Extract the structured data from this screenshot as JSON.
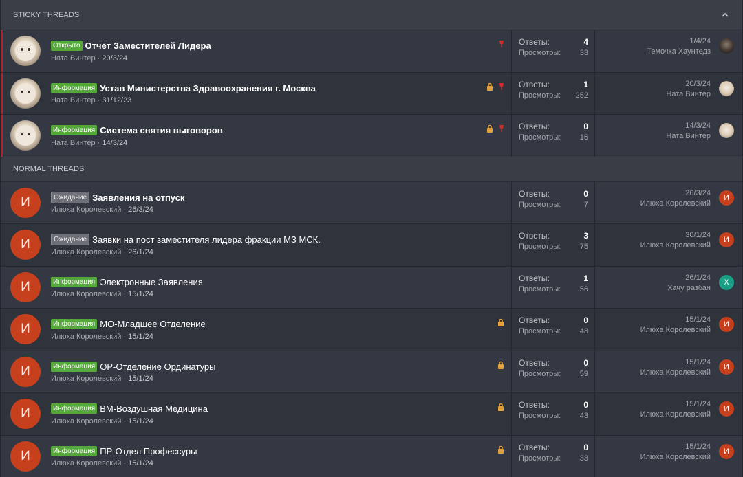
{
  "sticky_section": {
    "title": "STICKY THREADS"
  },
  "normal_section": {
    "title": "NORMAL THREADS"
  },
  "stats_labels": {
    "replies": "Ответы:",
    "views": "Просмотры:"
  },
  "sticky_threads": [
    {
      "prefix": "Открыто",
      "prefix_color": "green",
      "title": "Отчёт Заместителей Лидера",
      "author": "Ната Винтер",
      "date": "20/3/24",
      "locked": false,
      "pinned": true,
      "replies": "4",
      "views": "33",
      "last_date": "1/4/24",
      "last_user": "Темочка Хаунтедз",
      "avatar": "photo",
      "last_avatar": "dark"
    },
    {
      "prefix": "Информация",
      "prefix_color": "green",
      "title": "Устав Министерства Здравоохранения г. Москва",
      "author": "Ната Винтер",
      "date": "31/12/23",
      "locked": true,
      "pinned": true,
      "replies": "1",
      "views": "252",
      "last_date": "20/3/24",
      "last_user": "Ната Винтер",
      "avatar": "photo",
      "last_avatar": "photo"
    },
    {
      "prefix": "Информация",
      "prefix_color": "green",
      "title": "Система снятия выговоров",
      "author": "Ната Винтер",
      "date": "14/3/24",
      "locked": true,
      "pinned": true,
      "replies": "0",
      "views": "16",
      "last_date": "14/3/24",
      "last_user": "Ната Винтер",
      "avatar": "photo",
      "last_avatar": "photo"
    }
  ],
  "normal_threads": [
    {
      "prefix": "Ожидание",
      "prefix_color": "grey",
      "title": "Заявления на отпуск",
      "bold": true,
      "author": "Илюха Королевский",
      "date": "26/3/24",
      "locked": false,
      "replies": "0",
      "views": "7",
      "last_date": "26/3/24",
      "last_user": "Илюха Королевский",
      "avatar_letter": "И",
      "last_avatar": "red",
      "last_letter": "И"
    },
    {
      "prefix": "Ожидание",
      "prefix_color": "grey",
      "title": "Заявки на пост заместителя лидера фракции МЗ МСК.",
      "bold": false,
      "author": "Илюха Королевский",
      "date": "26/1/24",
      "locked": false,
      "replies": "3",
      "views": "75",
      "last_date": "30/1/24",
      "last_user": "Илюха Королевский",
      "avatar_letter": "И",
      "last_avatar": "red",
      "last_letter": "И"
    },
    {
      "prefix": "Информация",
      "prefix_color": "green",
      "title": "Электронные Заявления",
      "bold": false,
      "author": "Илюха Королевский",
      "date": "15/1/24",
      "locked": false,
      "replies": "1",
      "views": "56",
      "last_date": "26/1/24",
      "last_user": "Хачу разбан",
      "avatar_letter": "И",
      "last_avatar": "teal",
      "last_letter": "Х"
    },
    {
      "prefix": "Информация",
      "prefix_color": "green",
      "title": "МО-Младшее Отделение",
      "bold": false,
      "author": "Илюха Королевский",
      "date": "15/1/24",
      "locked": true,
      "replies": "0",
      "views": "48",
      "last_date": "15/1/24",
      "last_user": "Илюха Королевский",
      "avatar_letter": "И",
      "last_avatar": "red",
      "last_letter": "И"
    },
    {
      "prefix": "Информация",
      "prefix_color": "green",
      "title": "ОР-Отделение Ординатуры",
      "bold": false,
      "author": "Илюха Королевский",
      "date": "15/1/24",
      "locked": true,
      "replies": "0",
      "views": "59",
      "last_date": "15/1/24",
      "last_user": "Илюха Королевский",
      "avatar_letter": "И",
      "last_avatar": "red",
      "last_letter": "И"
    },
    {
      "prefix": "Информация",
      "prefix_color": "green",
      "title": "ВМ-Воздушная Медицина",
      "bold": false,
      "author": "Илюха Королевский",
      "date": "15/1/24",
      "locked": true,
      "replies": "0",
      "views": "43",
      "last_date": "15/1/24",
      "last_user": "Илюха Королевский",
      "avatar_letter": "И",
      "last_avatar": "red",
      "last_letter": "И"
    },
    {
      "prefix": "Информация",
      "prefix_color": "green",
      "title": "ПР-Отдел Профессуры",
      "bold": false,
      "author": "Илюха Королевский",
      "date": "15/1/24",
      "locked": true,
      "replies": "0",
      "views": "33",
      "last_date": "15/1/24",
      "last_user": "Илюха Королевский",
      "avatar_letter": "И",
      "last_avatar": "red",
      "last_letter": "И"
    }
  ]
}
